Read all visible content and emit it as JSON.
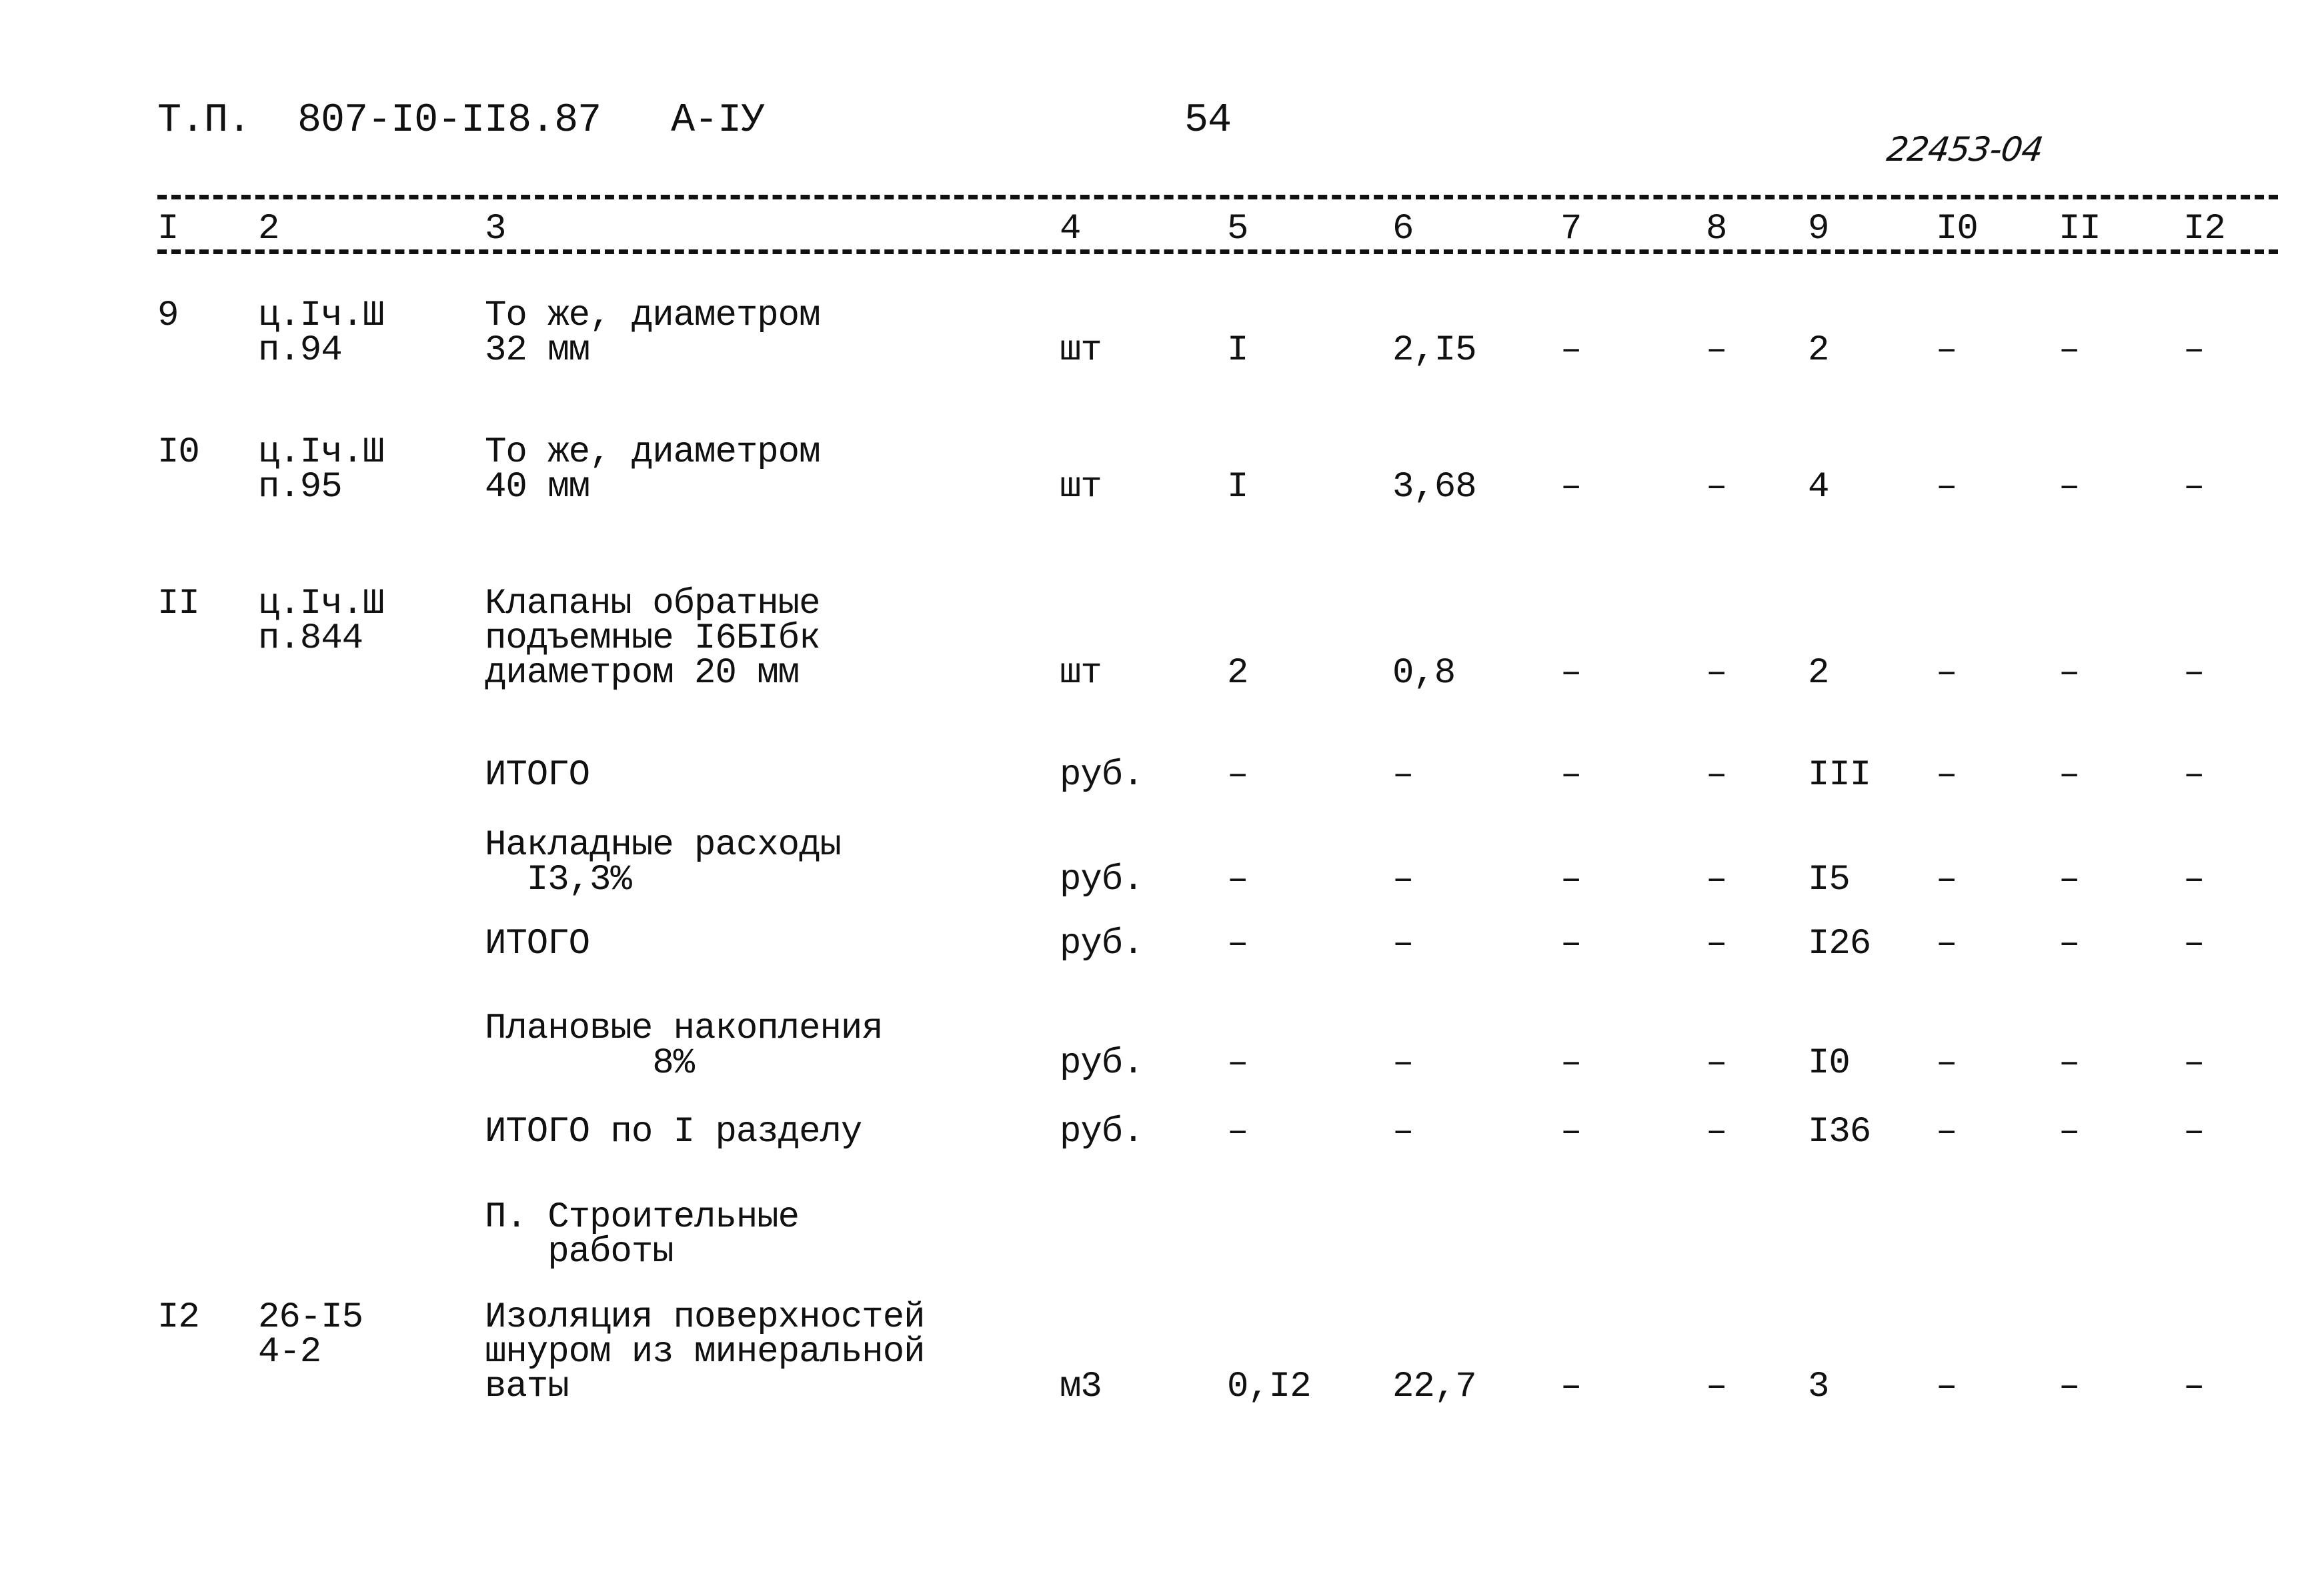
{
  "header": {
    "doc_code": "Т.П.  807-I0-II8.87   А-IУ",
    "page_number": "54",
    "handwritten_ref": "22453-04"
  },
  "columns": [
    "I",
    "2",
    "3",
    "4",
    "5",
    "6",
    "7",
    "8",
    "9",
    "I0",
    "II",
    "I2"
  ],
  "rows": [
    {
      "no": "9",
      "ref": [
        "ц.Iч.Ш",
        "п.94"
      ],
      "desc": [
        "То же, диаметром",
        "32 мм"
      ],
      "unit": "шт",
      "c5": "I",
      "c6": "2,I5",
      "c7": "–",
      "c8": "–",
      "c9": "2",
      "c10": "–",
      "c11": "–",
      "c12": "–"
    },
    {
      "no": "I0",
      "ref": [
        "ц.Iч.Ш",
        "п.95"
      ],
      "desc": [
        "То же, диаметром",
        "40 мм"
      ],
      "unit": "шт",
      "c5": "I",
      "c6": "3,68",
      "c7": "–",
      "c8": "–",
      "c9": "4",
      "c10": "–",
      "c11": "–",
      "c12": "–"
    },
    {
      "no": "II",
      "ref": [
        "ц.Iч.Ш",
        "п.844"
      ],
      "desc": [
        "Клапаны обратные",
        "подъемные I6БIбк",
        "диаметром 20 мм"
      ],
      "unit": "шт",
      "c5": "2",
      "c6": "0,8",
      "c7": "–",
      "c8": "–",
      "c9": "2",
      "c10": "–",
      "c11": "–",
      "c12": "–"
    }
  ],
  "totals": [
    {
      "label": [
        "ИТОГО"
      ],
      "unit": "руб.",
      "c5": "–",
      "c6": "–",
      "c7": "–",
      "c8": "–",
      "c9": "III",
      "c10": "–",
      "c11": "–",
      "c12": "–"
    },
    {
      "label": [
        "Накладные расходы",
        "  I3,3%"
      ],
      "unit": "руб.",
      "c5": "–",
      "c6": "–",
      "c7": "–",
      "c8": "–",
      "c9": "I5",
      "c10": "–",
      "c11": "–",
      "c12": "–"
    },
    {
      "label": [
        "ИТОГО"
      ],
      "unit": "руб.",
      "c5": "–",
      "c6": "–",
      "c7": "–",
      "c8": "–",
      "c9": "I26",
      "c10": "–",
      "c11": "–",
      "c12": "–"
    },
    {
      "label": [
        "Плановые накопления",
        "        8%"
      ],
      "unit": "руб.",
      "c5": "–",
      "c6": "–",
      "c7": "–",
      "c8": "–",
      "c9": "I0",
      "c10": "–",
      "c11": "–",
      "c12": "–"
    },
    {
      "label": [
        "ИТОГО по I разделу"
      ],
      "unit": "руб.",
      "c5": "–",
      "c6": "–",
      "c7": "–",
      "c8": "–",
      "c9": "I36",
      "c10": "–",
      "c11": "–",
      "c12": "–"
    }
  ],
  "section2": {
    "title": [
      "П. Строительные",
      "   работы"
    ]
  },
  "row12": {
    "no": "I2",
    "ref": [
      "26-I5",
      "4-2"
    ],
    "desc": [
      "Изоляция поверхностей",
      "шнуром из минеральной",
      "ваты"
    ],
    "unit": "м3",
    "c5": "0,I2",
    "c6": "22,7",
    "c7": "–",
    "c8": "–",
    "c9": "3",
    "c10": "–",
    "c11": "–",
    "c12": "–"
  }
}
